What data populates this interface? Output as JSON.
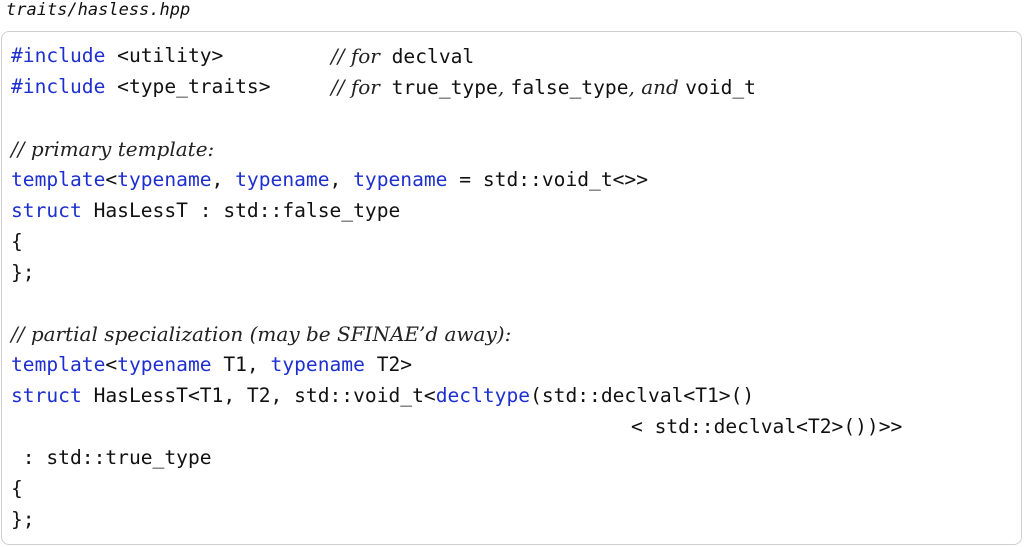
{
  "file": {
    "name": "traits/hasless.hpp"
  },
  "code": {
    "l1": {
      "kw": "#include",
      "rest": " <utility>",
      "c1": "// for",
      "c2": " declval"
    },
    "l2": {
      "kw": "#include",
      "rest": " <type_traits>",
      "c1": "// for",
      "c2": " true_type",
      "c3": ", ",
      "c4": "false_type",
      "c5": ", and ",
      "c6": "void_t"
    },
    "l3": {
      "c": "// primary template:"
    },
    "l4": {
      "kw1": "template",
      "t1": "<",
      "kw2": "typename",
      "t2": ", ",
      "kw3": "typename",
      "t3": ", ",
      "kw4": "typename",
      "t4": " = std::void_t<>>"
    },
    "l5": {
      "kw": "struct",
      "rest": " HasLessT : std::false_type"
    },
    "l6": {
      "t": "{"
    },
    "l7": {
      "t": "};"
    },
    "l8": {
      "c": "// partial specialization (may be SFINAE’d away):"
    },
    "l9": {
      "kw1": "template",
      "t1": "<",
      "kw2": "typename",
      "t2": " T1, ",
      "kw3": "typename",
      "t3": " T2>"
    },
    "l10": {
      "kw": "struct",
      "t1": " HasLessT<T1, T2, std::void_t<",
      "kw2": "decltype",
      "t2": "(std::declval<T1>()"
    },
    "l11": {
      "t": "< std::declval<T2>())>>"
    },
    "l12": {
      "t": " : std::true_type"
    },
    "l13": {
      "t": "{"
    },
    "l14": {
      "t": "};"
    }
  }
}
